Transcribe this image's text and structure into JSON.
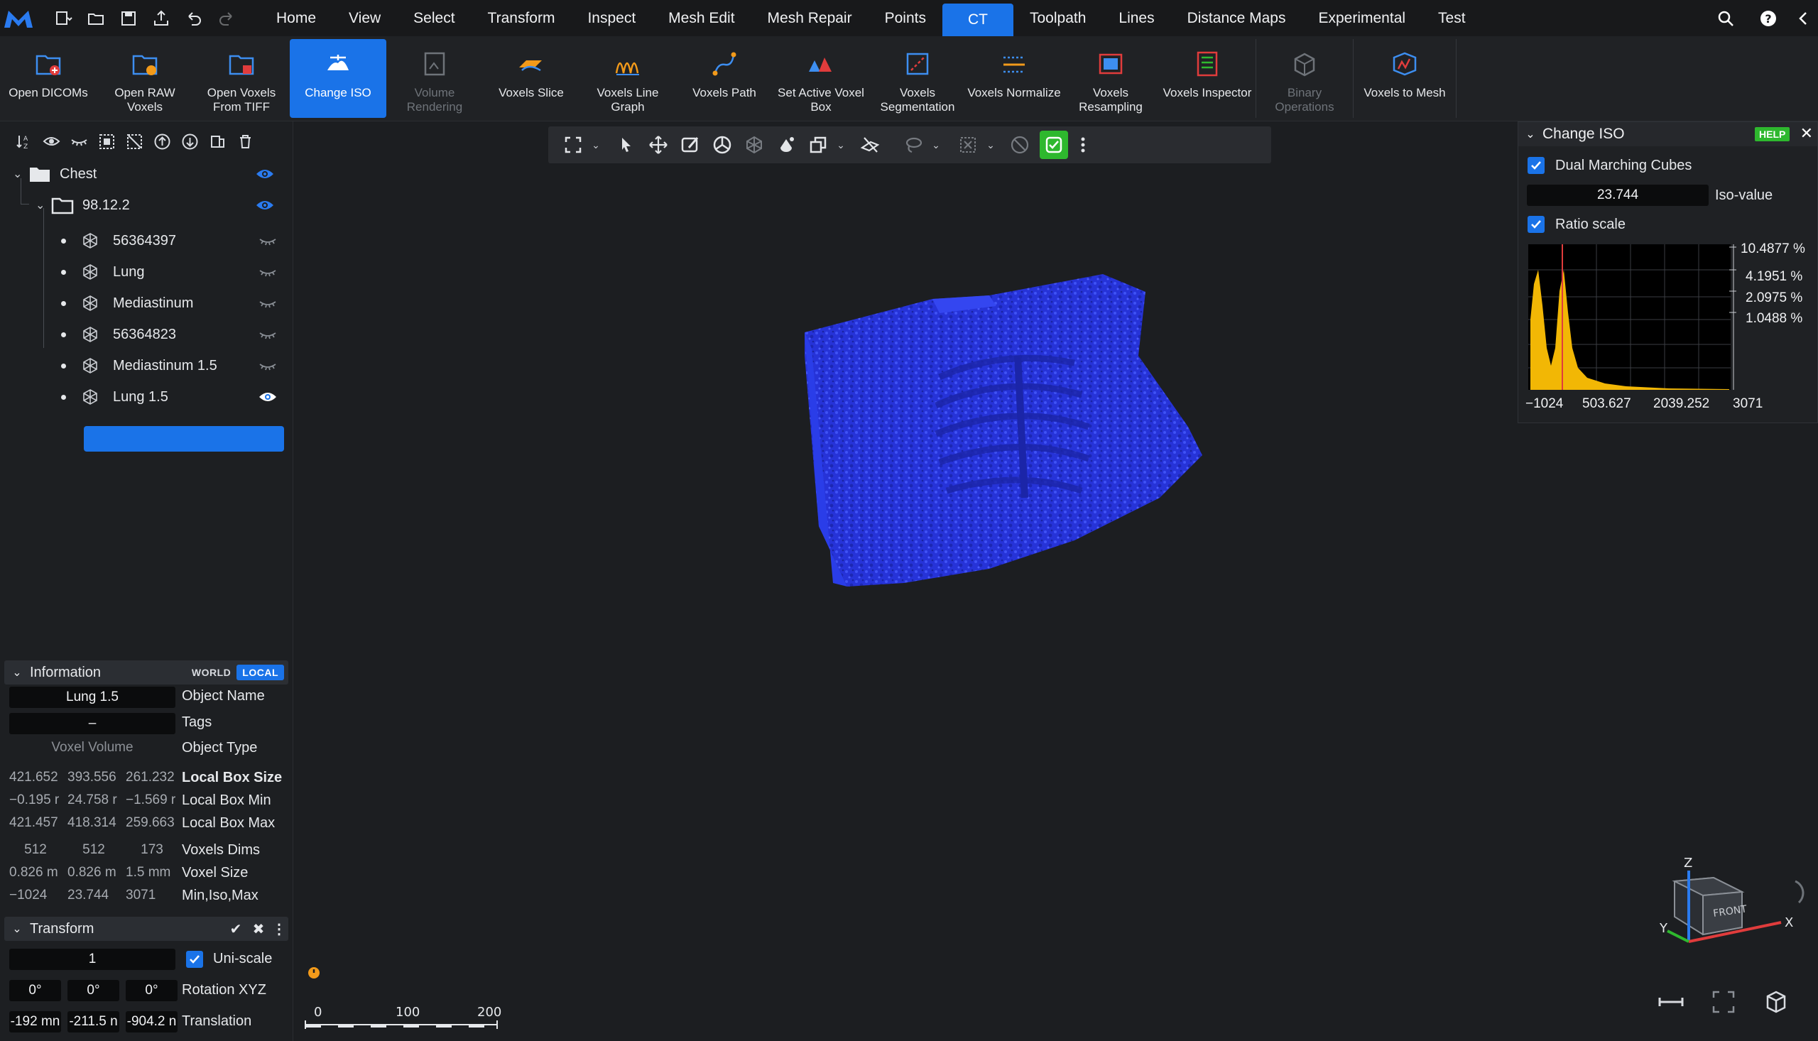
{
  "menubar": {
    "tabs": [
      "Home",
      "View",
      "Select",
      "Transform",
      "Inspect",
      "Mesh Edit",
      "Mesh Repair",
      "Points",
      "CT",
      "Toolpath",
      "Lines",
      "Distance Maps",
      "Experimental",
      "Test"
    ],
    "active_tab": "CT"
  },
  "ribbon": {
    "buttons": [
      {
        "label": "Open DICOMs"
      },
      {
        "label": "Open RAW Voxels"
      },
      {
        "label": "Open Voxels From TIFF"
      },
      {
        "label": "Change ISO"
      },
      {
        "label": "Volume Rendering"
      },
      {
        "label": "Voxels Slice"
      },
      {
        "label": "Voxels Line Graph"
      },
      {
        "label": "Voxels Path"
      },
      {
        "label": "Set Active Voxel Box"
      },
      {
        "label": "Voxels Segmentation"
      },
      {
        "label": "Voxels Normalize"
      },
      {
        "label": "Voxels Resampling"
      },
      {
        "label": "Voxels Inspector"
      },
      {
        "label": "Binary Operations"
      },
      {
        "label": "Voxels to Mesh"
      }
    ]
  },
  "tree": {
    "root": "Chest",
    "group": "98.12.2",
    "items": [
      "56364397",
      "Lung",
      "Mediastinum",
      "56364823",
      "Mediastinum 1.5",
      "Lung 1.5"
    ],
    "selected": "Lung 1.5"
  },
  "information": {
    "title": "Information",
    "world": "WORLD",
    "local": "LOCAL",
    "object_name_value": "Lung 1.5",
    "object_name_label": "Object Name",
    "tags_value": "–",
    "tags_label": "Tags",
    "object_type_value": "Voxel Volume",
    "object_type_label": "Object Type",
    "rows": [
      {
        "label": "Local Box Size",
        "v": [
          "421.652",
          "393.556",
          "261.232"
        ],
        "bold": true
      },
      {
        "label": "Local Box Min",
        "v": [
          "−0.195 r",
          "24.758 r",
          "−1.569 r"
        ]
      },
      {
        "label": "Local Box Max",
        "v": [
          "421.457",
          "418.314",
          "259.663"
        ]
      },
      {
        "label": "Voxels Dims",
        "v": [
          "512",
          "512",
          "173"
        ]
      },
      {
        "label": "Voxel Size",
        "v": [
          "0.826 m",
          "0.826 m",
          "1.5 mm"
        ]
      },
      {
        "label": "Min,Iso,Max",
        "v": [
          "−1024",
          "23.744",
          "3071"
        ]
      }
    ]
  },
  "transform": {
    "title": "Transform",
    "scale_value": "1",
    "uniscale_label": "Uni-scale",
    "rotation": [
      "0°",
      "0°",
      "0°"
    ],
    "rotation_label": "Rotation XYZ",
    "translation": [
      "-192 mn",
      "-211.5 n",
      "-904.2 n"
    ],
    "translation_label": "Translation"
  },
  "iso_panel": {
    "title": "Change ISO",
    "help": "HELP",
    "dual_mc_label": "Dual Marching Cubes",
    "iso_value": "23.744",
    "iso_label": "Iso-value",
    "ratio_label": "Ratio scale",
    "histogram": {
      "y_ticks": [
        "10.4877 %",
        "4.1951 %",
        "2.0975 %",
        "1.0488 %"
      ],
      "x_ticks": [
        "−1024",
        "503.627",
        "2039.252",
        "3071"
      ],
      "fill_color": "#f2b705",
      "marker_color": "#e03c3c"
    }
  },
  "scale_bar": {
    "ticks": [
      "0",
      "100",
      "200"
    ]
  },
  "axes": {
    "z": "Z",
    "y": "Y",
    "x": "X",
    "cube_face": "FRONT"
  },
  "colors": {
    "accent": "#1a73e8",
    "model": "#2a3df0",
    "ok": "#2eb82e"
  }
}
